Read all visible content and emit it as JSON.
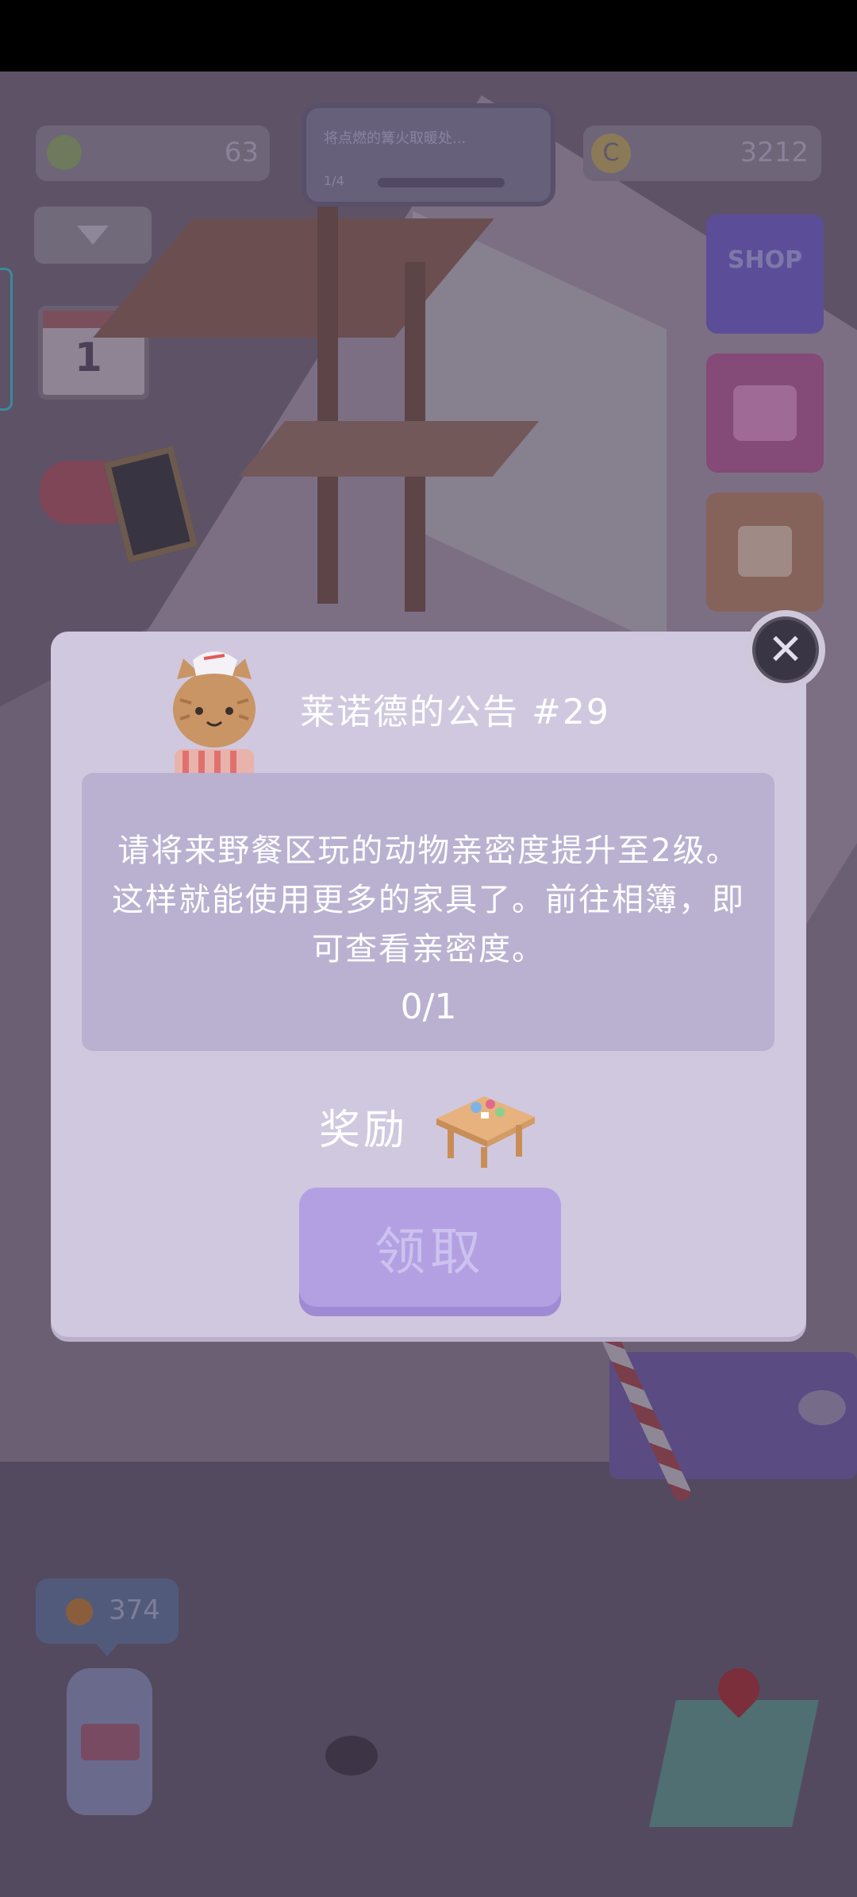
{
  "hud": {
    "leaf_count": "63",
    "coin_icon": "C",
    "coin_count": "3212",
    "quest_text": "将点燃的篝火取暖处... ",
    "quest_progress": "1/4",
    "shop_label": "SHOP",
    "calendar_day": "1",
    "counter": "374"
  },
  "dialog": {
    "title": "莱诺德的公告 #29",
    "description": "请将来野餐区玩的动物亲密度提升至2级。这样就能使用更多的家具了。前往相簿，即可查看亲密度。",
    "progress": "0/1",
    "reward_label": "奖励",
    "claim_label": "领取",
    "close_glyph": "✕"
  },
  "colors": {
    "modal_bg": "#d0c8df",
    "desc_box": "#bab1d1",
    "claim_button": "#b3a0e3",
    "close_button": "#3a3545"
  }
}
